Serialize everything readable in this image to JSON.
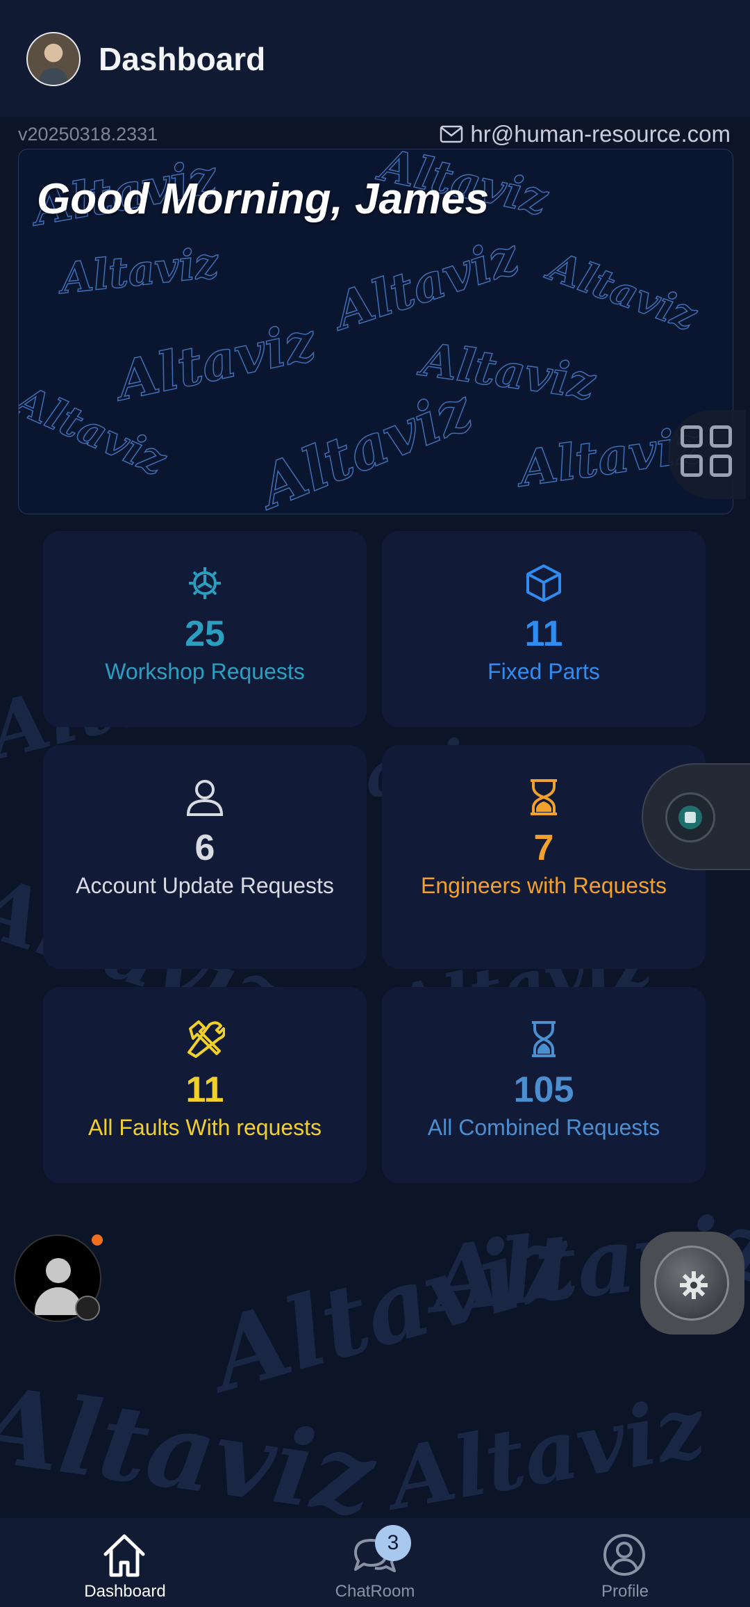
{
  "header": {
    "title": "Dashboard",
    "version": "v20250318.2331",
    "email": "hr@human-resource.com"
  },
  "banner": {
    "greeting": "Good Morning, James",
    "pattern_text": "Altaviz"
  },
  "cards": [
    {
      "count": "25",
      "label": "Workshop Requests",
      "icon": "gear-icon",
      "color": "#2a9fc0"
    },
    {
      "count": "11",
      "label": "Fixed Parts",
      "icon": "cube-icon",
      "color": "#2f8cf0"
    },
    {
      "count": "6",
      "label": "Account Update Requests",
      "icon": "user-icon",
      "color": "#d8dbe2"
    },
    {
      "count": "7",
      "label": "Engineers with Requests",
      "icon": "hourglass-icon",
      "color": "#f2a12c"
    },
    {
      "count": "11",
      "label": "All Faults With requests",
      "icon": "tools-icon",
      "color": "#f2d02c"
    },
    {
      "count": "105",
      "label": "All Combined Requests",
      "icon": "hourglass-icon",
      "color": "#4c8fd0"
    }
  ],
  "bottom_nav": {
    "items": [
      {
        "label": "Dashboard",
        "icon": "home-icon",
        "active": true
      },
      {
        "label": "ChatRoom",
        "icon": "chat-icon",
        "active": false
      },
      {
        "label": "Profile",
        "icon": "profile-icon",
        "active": false
      }
    ],
    "chat_badge": "3"
  },
  "colors": {
    "background": "#0c1428",
    "card": "#111b38",
    "active_nav": "#ffffff",
    "inactive_nav": "#8a93a6"
  }
}
